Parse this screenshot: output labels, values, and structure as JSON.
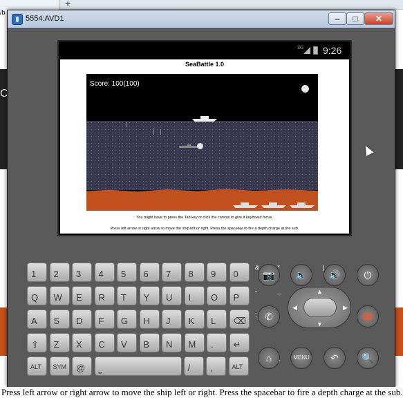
{
  "window": {
    "title": "5554:AVD1",
    "minimize_label": "–",
    "maximize_label": "□",
    "close_label": "✕"
  },
  "browser": {
    "new_tab_label": "+",
    "tab_fragment": "/b"
  },
  "side_fragment": "Co",
  "statusbar": {
    "network": "3G",
    "time": "9:26"
  },
  "app": {
    "title": "SeaBattle 1.0",
    "score": "Score: 100(100)",
    "help_focus": "You might have to press the Tab key or click the canvas to give it keyboard focus.",
    "help_controls": "Press left arrow or right arrow to move the ship left or right. Press the spacebar to fire a depth charge at the sub."
  },
  "page_footer_text": "Press left arrow or right arrow to move the ship left or right. Press the spacebar to fire a depth charge at the sub.",
  "keyboard": {
    "rows": [
      [
        {
          "main": "1",
          "sub": "!"
        },
        {
          "main": "2",
          "sub": "@"
        },
        {
          "main": "3",
          "sub": "#"
        },
        {
          "main": "4",
          "sub": "$"
        },
        {
          "main": "5",
          "sub": "%"
        },
        {
          "main": "6",
          "sub": "^"
        },
        {
          "main": "7",
          "sub": "&"
        },
        {
          "main": "8",
          "sub": "*"
        },
        {
          "main": "9",
          "sub": "("
        },
        {
          "main": "0",
          "sub": ")"
        }
      ],
      [
        {
          "main": "Q",
          "sub": "`"
        },
        {
          "main": "W",
          "sub": "~"
        },
        {
          "main": "E",
          "sub": "\""
        },
        {
          "main": "R",
          "sub": "'"
        },
        {
          "main": "T",
          "sub": "{"
        },
        {
          "main": "Y",
          "sub": "}"
        },
        {
          "main": "U",
          "sub": "-"
        },
        {
          "main": "I",
          "sub": "_"
        },
        {
          "main": "O",
          "sub": "+"
        },
        {
          "main": "P",
          "sub": "="
        }
      ],
      [
        {
          "main": "A",
          "sub": "|"
        },
        {
          "main": "S",
          "sub": "\\"
        },
        {
          "main": "D",
          "sub": "["
        },
        {
          "main": "F",
          "sub": "]"
        },
        {
          "main": "G",
          "sub": "<"
        },
        {
          "main": "H",
          "sub": ">"
        },
        {
          "main": "J",
          "sub": ";"
        },
        {
          "main": "K",
          "sub": ":"
        },
        {
          "main": "L",
          "sub": "\""
        },
        {
          "main": "⌫",
          "sub": "DEL"
        }
      ],
      [
        {
          "main": "⇧",
          "sub": ""
        },
        {
          "main": "Z",
          "sub": ""
        },
        {
          "main": "X",
          "sub": ""
        },
        {
          "main": "C",
          "sub": ""
        },
        {
          "main": "V",
          "sub": ""
        },
        {
          "main": "B",
          "sub": ""
        },
        {
          "main": "N",
          "sub": ""
        },
        {
          "main": "M",
          "sub": ""
        },
        {
          "main": ".",
          "sub": ""
        },
        {
          "main": "↵",
          "sub": ""
        }
      ],
      [
        {
          "main": "ALT",
          "sub": ""
        },
        {
          "main": "SYM",
          "sub": ""
        },
        {
          "main": "@",
          "sub": ""
        },
        {
          "main": "⎵",
          "sub": ""
        },
        {
          "main": "/",
          "sub": "?"
        },
        {
          "main": ",",
          "sub": ""
        },
        {
          "main": "ALT",
          "sub": ""
        }
      ]
    ]
  },
  "controls": {
    "camera": "📷",
    "vol_down": "🔈",
    "vol_up": "🔊",
    "power": "⏻",
    "call": "✆",
    "end_call": "☎",
    "home": "⌂",
    "menu": "MENU",
    "back": "↶",
    "search": "🔍"
  }
}
